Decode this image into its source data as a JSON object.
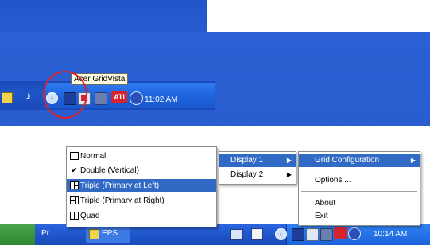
{
  "top_screenshot": {
    "tooltip": "Acer GridVista",
    "clock": "11:02 AM"
  },
  "bottom_screenshot": {
    "layout_menu": {
      "items": [
        {
          "label": "Normal",
          "icon": "layout-normal-icon",
          "checked": false,
          "selected": false
        },
        {
          "label": "Double (Vertical)",
          "icon": "check-icon",
          "checked": true,
          "selected": false
        },
        {
          "label": "Triple (Primary at Left)",
          "icon": "layout-triple-left-icon",
          "checked": false,
          "selected": true
        },
        {
          "label": "Triple (Primary at Right)",
          "icon": "layout-triple-right-icon",
          "checked": false,
          "selected": false
        },
        {
          "label": "Quad",
          "icon": "layout-quad-icon",
          "checked": false,
          "selected": false
        }
      ]
    },
    "display_menu": {
      "items": [
        {
          "label": "Display 1",
          "selected": true
        },
        {
          "label": "Display 2",
          "selected": false
        }
      ]
    },
    "main_menu": {
      "items": [
        {
          "label": "Grid Configuration",
          "selected": true
        },
        {
          "label": "Options ...",
          "selected": false
        },
        {
          "label": "About",
          "selected": false
        },
        {
          "label": "Exit",
          "selected": false
        }
      ]
    },
    "taskbar": {
      "task1": "Pr...",
      "task2": "EPS",
      "clock": "10:14 AM"
    }
  },
  "colors": {
    "xp_blue": "#2b60d4",
    "menu_highlight": "#316ac5",
    "annotation_red": "#d8232a",
    "tooltip_bg": "#ffffe1"
  }
}
